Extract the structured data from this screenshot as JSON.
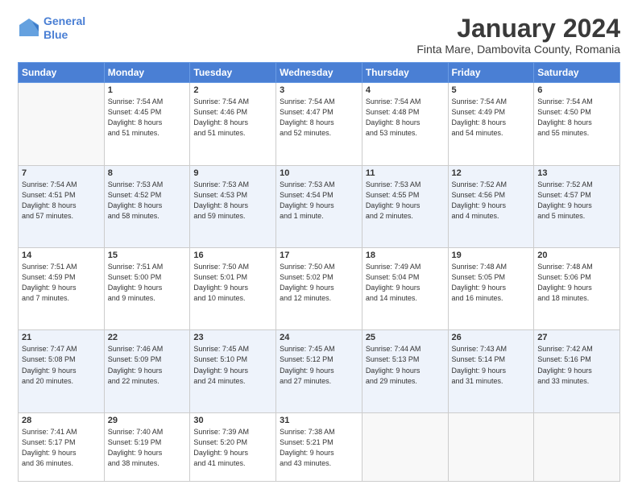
{
  "header": {
    "logo_line1": "General",
    "logo_line2": "Blue",
    "month_title": "January 2024",
    "location": "Finta Mare, Dambovita County, Romania"
  },
  "weekdays": [
    "Sunday",
    "Monday",
    "Tuesday",
    "Wednesday",
    "Thursday",
    "Friday",
    "Saturday"
  ],
  "weeks": [
    [
      {
        "day": "",
        "info": ""
      },
      {
        "day": "1",
        "info": "Sunrise: 7:54 AM\nSunset: 4:45 PM\nDaylight: 8 hours\nand 51 minutes."
      },
      {
        "day": "2",
        "info": "Sunrise: 7:54 AM\nSunset: 4:46 PM\nDaylight: 8 hours\nand 51 minutes."
      },
      {
        "day": "3",
        "info": "Sunrise: 7:54 AM\nSunset: 4:47 PM\nDaylight: 8 hours\nand 52 minutes."
      },
      {
        "day": "4",
        "info": "Sunrise: 7:54 AM\nSunset: 4:48 PM\nDaylight: 8 hours\nand 53 minutes."
      },
      {
        "day": "5",
        "info": "Sunrise: 7:54 AM\nSunset: 4:49 PM\nDaylight: 8 hours\nand 54 minutes."
      },
      {
        "day": "6",
        "info": "Sunrise: 7:54 AM\nSunset: 4:50 PM\nDaylight: 8 hours\nand 55 minutes."
      }
    ],
    [
      {
        "day": "7",
        "info": "Sunrise: 7:54 AM\nSunset: 4:51 PM\nDaylight: 8 hours\nand 57 minutes."
      },
      {
        "day": "8",
        "info": "Sunrise: 7:53 AM\nSunset: 4:52 PM\nDaylight: 8 hours\nand 58 minutes."
      },
      {
        "day": "9",
        "info": "Sunrise: 7:53 AM\nSunset: 4:53 PM\nDaylight: 8 hours\nand 59 minutes."
      },
      {
        "day": "10",
        "info": "Sunrise: 7:53 AM\nSunset: 4:54 PM\nDaylight: 9 hours\nand 1 minute."
      },
      {
        "day": "11",
        "info": "Sunrise: 7:53 AM\nSunset: 4:55 PM\nDaylight: 9 hours\nand 2 minutes."
      },
      {
        "day": "12",
        "info": "Sunrise: 7:52 AM\nSunset: 4:56 PM\nDaylight: 9 hours\nand 4 minutes."
      },
      {
        "day": "13",
        "info": "Sunrise: 7:52 AM\nSunset: 4:57 PM\nDaylight: 9 hours\nand 5 minutes."
      }
    ],
    [
      {
        "day": "14",
        "info": "Sunrise: 7:51 AM\nSunset: 4:59 PM\nDaylight: 9 hours\nand 7 minutes."
      },
      {
        "day": "15",
        "info": "Sunrise: 7:51 AM\nSunset: 5:00 PM\nDaylight: 9 hours\nand 9 minutes."
      },
      {
        "day": "16",
        "info": "Sunrise: 7:50 AM\nSunset: 5:01 PM\nDaylight: 9 hours\nand 10 minutes."
      },
      {
        "day": "17",
        "info": "Sunrise: 7:50 AM\nSunset: 5:02 PM\nDaylight: 9 hours\nand 12 minutes."
      },
      {
        "day": "18",
        "info": "Sunrise: 7:49 AM\nSunset: 5:04 PM\nDaylight: 9 hours\nand 14 minutes."
      },
      {
        "day": "19",
        "info": "Sunrise: 7:48 AM\nSunset: 5:05 PM\nDaylight: 9 hours\nand 16 minutes."
      },
      {
        "day": "20",
        "info": "Sunrise: 7:48 AM\nSunset: 5:06 PM\nDaylight: 9 hours\nand 18 minutes."
      }
    ],
    [
      {
        "day": "21",
        "info": "Sunrise: 7:47 AM\nSunset: 5:08 PM\nDaylight: 9 hours\nand 20 minutes."
      },
      {
        "day": "22",
        "info": "Sunrise: 7:46 AM\nSunset: 5:09 PM\nDaylight: 9 hours\nand 22 minutes."
      },
      {
        "day": "23",
        "info": "Sunrise: 7:45 AM\nSunset: 5:10 PM\nDaylight: 9 hours\nand 24 minutes."
      },
      {
        "day": "24",
        "info": "Sunrise: 7:45 AM\nSunset: 5:12 PM\nDaylight: 9 hours\nand 27 minutes."
      },
      {
        "day": "25",
        "info": "Sunrise: 7:44 AM\nSunset: 5:13 PM\nDaylight: 9 hours\nand 29 minutes."
      },
      {
        "day": "26",
        "info": "Sunrise: 7:43 AM\nSunset: 5:14 PM\nDaylight: 9 hours\nand 31 minutes."
      },
      {
        "day": "27",
        "info": "Sunrise: 7:42 AM\nSunset: 5:16 PM\nDaylight: 9 hours\nand 33 minutes."
      }
    ],
    [
      {
        "day": "28",
        "info": "Sunrise: 7:41 AM\nSunset: 5:17 PM\nDaylight: 9 hours\nand 36 minutes."
      },
      {
        "day": "29",
        "info": "Sunrise: 7:40 AM\nSunset: 5:19 PM\nDaylight: 9 hours\nand 38 minutes."
      },
      {
        "day": "30",
        "info": "Sunrise: 7:39 AM\nSunset: 5:20 PM\nDaylight: 9 hours\nand 41 minutes."
      },
      {
        "day": "31",
        "info": "Sunrise: 7:38 AM\nSunset: 5:21 PM\nDaylight: 9 hours\nand 43 minutes."
      },
      {
        "day": "",
        "info": ""
      },
      {
        "day": "",
        "info": ""
      },
      {
        "day": "",
        "info": ""
      }
    ]
  ]
}
